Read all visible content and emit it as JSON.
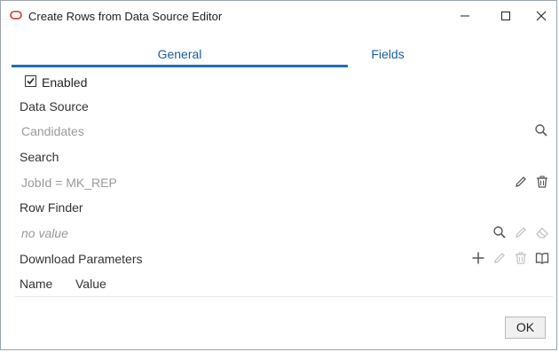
{
  "window": {
    "title": "Create Rows from Data Source Editor"
  },
  "tabs": [
    {
      "label": "General",
      "active": true
    },
    {
      "label": "Fields",
      "active": false
    }
  ],
  "general": {
    "enabled_label": "Enabled",
    "enabled_checked": true,
    "data_source": {
      "label": "Data Source",
      "value": "Candidates"
    },
    "search": {
      "label": "Search",
      "value": "JobId = MK_REP"
    },
    "row_finder": {
      "label": "Row Finder",
      "value": "no value"
    },
    "download_parameters": {
      "label": "Download Parameters",
      "columns": [
        "Name",
        "Value"
      ]
    }
  },
  "footer": {
    "ok_label": "OK"
  },
  "colors": {
    "accent": "#1f6eb8",
    "tab_text": "#1a5d9a",
    "muted_text": "#9a9a9a"
  }
}
